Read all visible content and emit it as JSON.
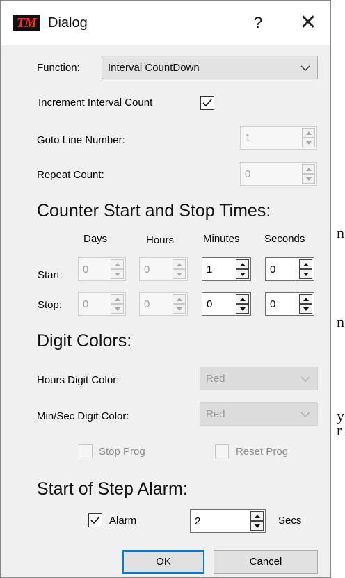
{
  "background_fragments": [
    "n",
    "n",
    "y",
    "r"
  ],
  "dialog": {
    "title": "Dialog",
    "logo_text": "TM",
    "help_label": "?",
    "close_label": "✕"
  },
  "function": {
    "label": "Function:",
    "value": "Interval CountDown"
  },
  "increment": {
    "label": "Increment Interval Count",
    "checked": true
  },
  "goto": {
    "label": "Goto Line Number:",
    "value": "1"
  },
  "repeat": {
    "label": "Repeat Count:",
    "value": "0"
  },
  "counter": {
    "heading": "Counter Start and Stop Times:",
    "columns": [
      "Days",
      "Hours",
      "Minutes",
      "Seconds"
    ],
    "start_label": "Start:",
    "stop_label": "Stop:",
    "start_values": [
      "0",
      "0",
      "1",
      "0"
    ],
    "stop_values": [
      "0",
      "0",
      "0",
      "0"
    ]
  },
  "digit_colors": {
    "heading": "Digit Colors:",
    "hours_label": "Hours Digit Color:",
    "hours_value": "Red",
    "minsec_label": "Min/Sec Digit Color:",
    "minsec_value": "Red"
  },
  "prog": {
    "stop_label": "Stop Prog",
    "reset_label": "Reset Prog"
  },
  "alarm": {
    "heading": "Start of Step Alarm:",
    "checkbox_label": "Alarm",
    "checked": true,
    "value": "2",
    "unit": "Secs"
  },
  "buttons": {
    "ok": "OK",
    "cancel": "Cancel"
  },
  "colors": {
    "default_button_border": "#0a78d7",
    "logo_red": "#ff2a1a",
    "dialog_bg": "#f0f0f0"
  }
}
